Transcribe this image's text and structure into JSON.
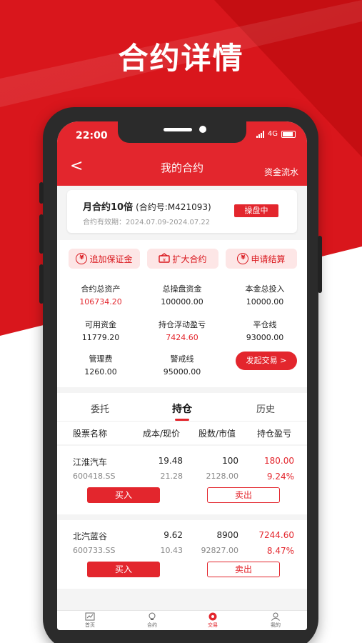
{
  "promo": {
    "title": "合约详情"
  },
  "status_bar": {
    "time": "22:00",
    "network": "4G"
  },
  "nav": {
    "back": "<",
    "title": "我的合约",
    "right_link": "资金流水"
  },
  "contract": {
    "name": "月合约10倍",
    "number": "(合约号:M421093)",
    "validity": "合约有效期：2024.07.09-2024.07.22",
    "status": "操盘中"
  },
  "actions": [
    {
      "label": "追加保证金",
      "icon": "yen-icon"
    },
    {
      "label": "扩大合约",
      "icon": "expand-icon"
    },
    {
      "label": "申请结算",
      "icon": "yen-icon"
    }
  ],
  "stats": [
    {
      "label": "合约总资产",
      "value": "106734.20",
      "highlight": true
    },
    {
      "label": "总操盘资金",
      "value": "100000.00",
      "highlight": false
    },
    {
      "label": "本金总投入",
      "value": "10000.00",
      "highlight": false
    },
    {
      "label": "可用资金",
      "value": "11779.20",
      "highlight": false
    },
    {
      "label": "持仓浮动盈亏",
      "value": "7424.60",
      "highlight": true
    },
    {
      "label": "平仓线",
      "value": "93000.00",
      "highlight": false
    },
    {
      "label": "管理费",
      "value": "1260.00",
      "highlight": false
    },
    {
      "label": "警戒线",
      "value": "95000.00",
      "highlight": false
    }
  ],
  "trade_button": "发起交易 >",
  "tabs": [
    "委托",
    "持仓",
    "历史"
  ],
  "active_tab": "持仓",
  "table_headers": [
    "股票名称",
    "成本/现价",
    "股数/市值",
    "持仓盈亏"
  ],
  "positions": [
    {
      "name": "江淮汽车",
      "code": "600418.SS",
      "cost": "19.48",
      "price": "21.28",
      "shares": "100",
      "market_value": "2128.00",
      "pnl": "180.00",
      "pnl_pct": "9.24%"
    },
    {
      "name": "北汽蓝谷",
      "code": "600733.SS",
      "cost": "9.62",
      "price": "10.43",
      "shares": "8900",
      "market_value": "92827.00",
      "pnl": "7244.60",
      "pnl_pct": "8.47%"
    }
  ],
  "buy_label": "买入",
  "sell_label": "卖出",
  "bottom_tabs": [
    {
      "label": "首页",
      "icon": "chart-icon"
    },
    {
      "label": "合约",
      "icon": "bulb-icon"
    },
    {
      "label": "交易",
      "icon": "trade-icon"
    },
    {
      "label": "我的",
      "icon": "user-icon"
    }
  ],
  "active_bottom_tab": "交易",
  "colors": {
    "brand_red": "#e3262d",
    "background_red": "#d9161c",
    "light_pill": "#fde6e6"
  }
}
